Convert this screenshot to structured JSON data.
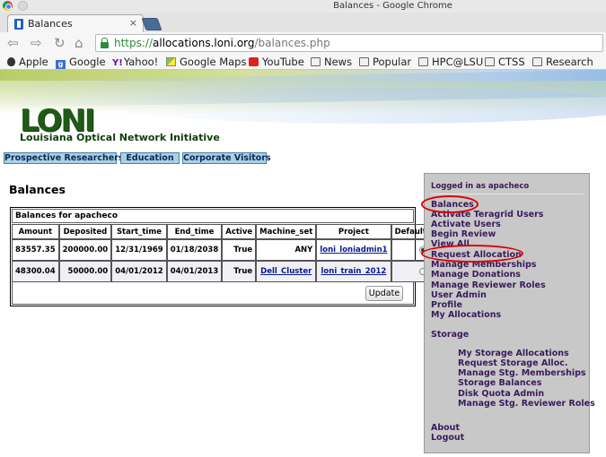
{
  "window": {
    "title": "Balances - Google Chrome"
  },
  "tab": {
    "label": "Balances",
    "close": "×"
  },
  "nav": {
    "back": "⇦",
    "forward": "⇨",
    "reload": "↻",
    "home": "⌂"
  },
  "address": {
    "scheme": "https://",
    "host": "allocations.loni.org",
    "path": "/balances.php"
  },
  "bookmarks": [
    {
      "label": "Apple",
      "icon": "apple-icon"
    },
    {
      "label": "Google",
      "icon": "google-icon"
    },
    {
      "label": "Yahoo!",
      "icon": "yahoo-icon"
    },
    {
      "label": "Google Maps",
      "icon": "maps-icon"
    },
    {
      "label": "YouTube",
      "icon": "youtube-icon"
    },
    {
      "label": "News",
      "icon": "folder-icon"
    },
    {
      "label": "Popular",
      "icon": "folder-icon"
    },
    {
      "label": "HPC@LSU",
      "icon": "folder-icon"
    },
    {
      "label": "CTSS",
      "icon": "folder-icon"
    },
    {
      "label": "Research",
      "icon": "folder-icon"
    }
  ],
  "banner": {
    "logo": "LONI",
    "subtitle": "Louisiana Optical Network Initiative",
    "tabs": [
      "Prospective Researchers",
      "Education",
      "Corporate Visitors"
    ]
  },
  "main": {
    "title": "Balances",
    "caption": "Balances for apacheco",
    "columns": [
      "Amount",
      "Deposited",
      "Start_time",
      "End_time",
      "Active",
      "Machine_set",
      "Project",
      "Default"
    ],
    "rows": [
      {
        "amount": "83557.35",
        "deposited": "200000.00",
        "start": "12/31/1969",
        "end": "01/18/2038",
        "active": "True",
        "machine_set": "ANY",
        "project": "loni_loniadmin1",
        "default": true
      },
      {
        "amount": "48300.04",
        "deposited": "50000.00",
        "start": "04/01/2012",
        "end": "04/01/2013",
        "active": "True",
        "machine_set": "Dell_Cluster",
        "project": "loni_train_2012",
        "default": false
      }
    ],
    "update_label": "Update"
  },
  "sidebar": {
    "logged_in": "Logged in as apacheco",
    "links": [
      "Balances",
      "Activate Teragrid Users",
      "Activate Users",
      "Begin Review",
      "View All",
      "Request Allocation",
      "Manage Memberships",
      "Manage Donations",
      "Manage Reviewer Roles",
      "User Admin",
      "Profile",
      "My Allocations"
    ],
    "storage_heading": "Storage",
    "storage_links": [
      "My Storage Allocations",
      "Request Storage Alloc.",
      "Manage Stg. Memberships",
      "Storage Balances",
      "Disk Quota Admin",
      "Manage Stg. Reviewer Roles"
    ],
    "footer_links": [
      "About",
      "Logout"
    ],
    "highlight_color": "#dd0000"
  }
}
